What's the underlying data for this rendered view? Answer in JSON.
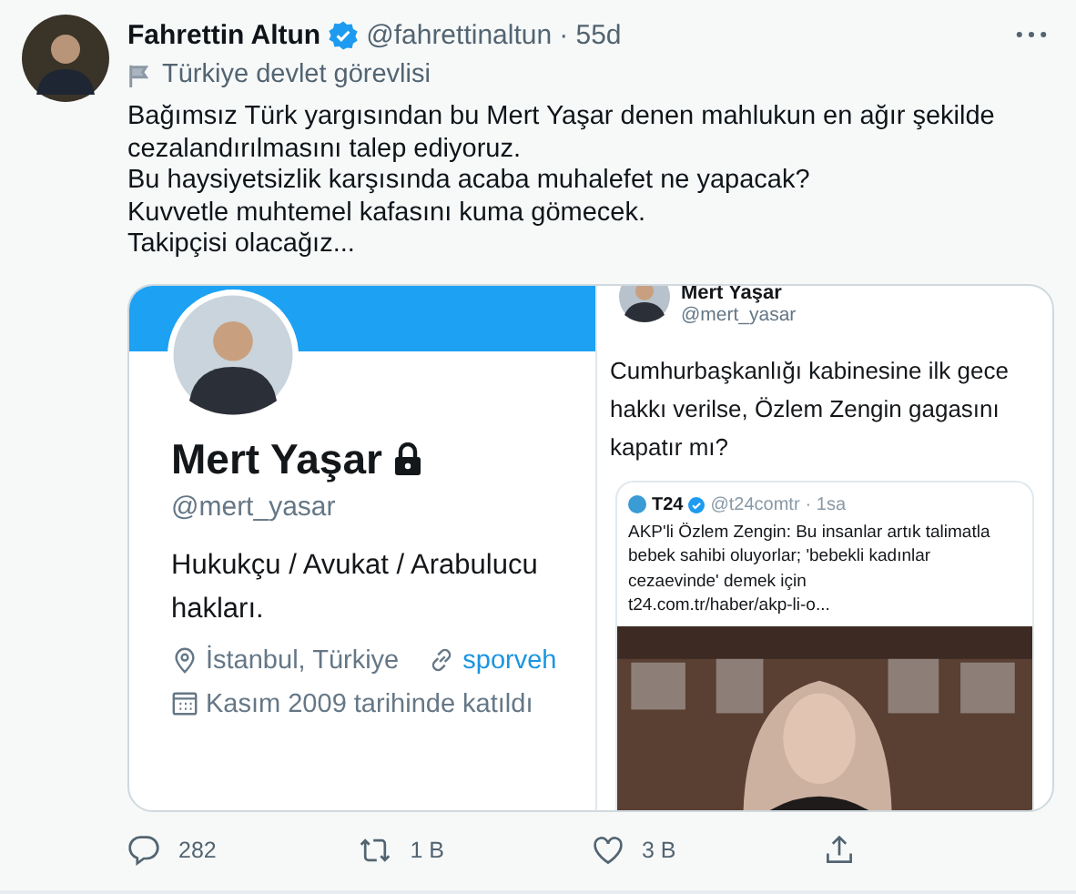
{
  "tweet": {
    "author": {
      "name": "Fahrettin Altun",
      "verified": true,
      "handle": "@fahrettinaltun",
      "time": "· 55d"
    },
    "label": "Türkiye devlet görevlisi",
    "text_lines": [
      "Bağımsız Türk yargısından bu Mert Yaşar denen mahlukun en ağır şekilde",
      "cezalandırılmasını talep ediyoruz.",
      "Bu haysiyetsizlik karşısında acaba muhalefet ne yapacak?",
      "Kuvvetle muhtemel kafasını kuma gömecek.",
      "Takipçisi olacağız..."
    ],
    "media": {
      "profile_card": {
        "name": "Mert Yaşar",
        "protected": true,
        "handle": "@mert_yasar",
        "bio_lines": [
          "Hukukçu / Avukat / Arabulucu",
          "hakları."
        ],
        "location": "İstanbul, Türkiye",
        "link": "sporveh",
        "joined": "Kasım 2009 tarihinde katıldı"
      },
      "quoted_tweet": {
        "name": "Mert Yaşar",
        "handle": "@mert_yasar",
        "text_lines": [
          "Cumhurbaşkanlığı kabinesine ilk gece",
          "hakkı verilse, Özlem Zengin gagasını",
          "kapatır mı?"
        ],
        "card": {
          "source": "T24",
          "verified": true,
          "handle": "@t24comtr",
          "time": "· 1sa",
          "text_lines": [
            "AKP'li Özlem Zengin: Bu insanlar artık talimatla",
            "bebek sahibi oluyorlar; 'bebekli kadınlar",
            "cezaevinde' demek için",
            "t24.com.tr/haber/akp-li-o..."
          ]
        }
      }
    },
    "actions": [
      {
        "kind": "reply",
        "count": "282"
      },
      {
        "kind": "retweet",
        "count": "1 B"
      },
      {
        "kind": "like",
        "count": "3 B"
      },
      {
        "kind": "share"
      }
    ]
  }
}
